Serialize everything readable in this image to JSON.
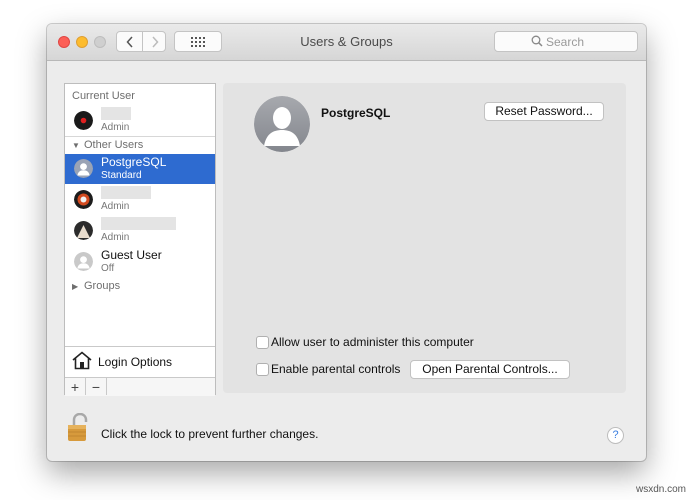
{
  "window": {
    "title": "Users & Groups"
  },
  "search": {
    "placeholder": "Search"
  },
  "sidebar": {
    "current_user_header": "Current User",
    "current_user": {
      "name": "",
      "role": "Admin"
    },
    "other_users_header": "Other Users",
    "other_users": [
      {
        "name": "PostgreSQL",
        "role": "Standard",
        "selected": true
      },
      {
        "name": "",
        "role": "Admin"
      },
      {
        "name": "",
        "role": "Admin"
      },
      {
        "name": "Guest User",
        "role": "Off"
      }
    ],
    "groups_label": "Groups",
    "login_options_label": "Login Options",
    "add_label": "+",
    "remove_label": "−"
  },
  "detail": {
    "user_name": "PostgreSQL",
    "reset_password_label": "Reset Password...",
    "allow_admin_label": "Allow user to administer this computer",
    "parental_controls_label": "Enable parental controls",
    "open_parental_label": "Open Parental Controls..."
  },
  "footer": {
    "lock_text": "Click the lock to prevent further changes.",
    "help_label": "?"
  },
  "watermark": "wsxdn.com",
  "colors": {
    "selection": "#2e6bd0",
    "window_bg": "#ececec",
    "pane_bg": "#e3e3e3"
  }
}
